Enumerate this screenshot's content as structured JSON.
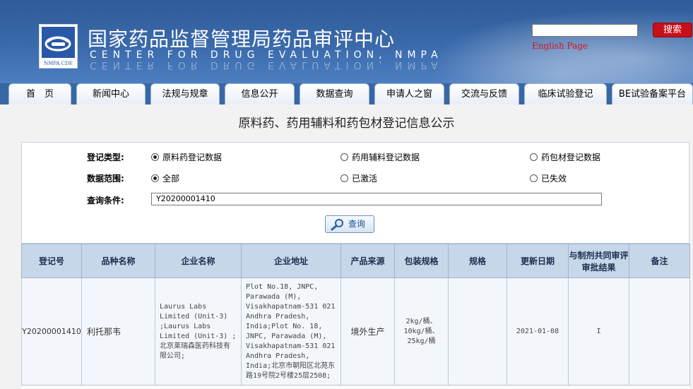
{
  "header": {
    "title_cn": "国家药品监督管理局药品审评中心",
    "title_en": "CENTER FOR DRUG EVALUATION, NMPA",
    "logo_text": "NMPA CDE",
    "search_button": "搜索",
    "english_link": "English Page"
  },
  "nav": {
    "tabs": [
      "首　页",
      "新闻中心",
      "法规与规章",
      "信息公开",
      "数据查询",
      "申请人之窗",
      "交流与反馈",
      "临床试验登记",
      "BE试验备案平台"
    ]
  },
  "page_title": "原料药、药用辅料和药包材登记信息公示",
  "form": {
    "type_label": "登记类型:",
    "type_options": [
      "原料药登记数据",
      "药用辅料登记数据",
      "药包材登记数据"
    ],
    "type_selected": 0,
    "range_label": "数据范围:",
    "range_options": [
      "全部",
      "已激活",
      "已失效"
    ],
    "range_selected": 0,
    "query_label": "查询条件:",
    "query_value": "Y20200001410",
    "query_button": "查询"
  },
  "table": {
    "headers": [
      "登记号",
      "品种名称",
      "企业名称",
      "企业地址",
      "产品来源",
      "包装规格",
      "规格",
      "更新日期",
      "与制剂共同审评审批结果",
      "备注"
    ],
    "rows": [
      {
        "reg_no": "Y20200001410",
        "product": "利托那韦",
        "company": "Laurus Labs Limited (Unit-3) ;Laurus Labs Limited (Unit-3) ;北京莱瑞森医药科技有限公司;",
        "address": "Plot No.18, JNPC, Parawada (M), Visakhapatnam-531 021 Andhra Pradesh, India;Plot No. 18, JNPC, Parawada (M), Visakhapatnam-531 021 Andhra Pradesh, India;北京市朝阳区北苑东路19号院2号楼25层2508;",
        "source": "境外生产",
        "package": "2kg/桶、10kg/桶、25kg/桶",
        "spec": "",
        "update_date": "2021-01-08",
        "result": "I",
        "remark": ""
      }
    ]
  }
}
